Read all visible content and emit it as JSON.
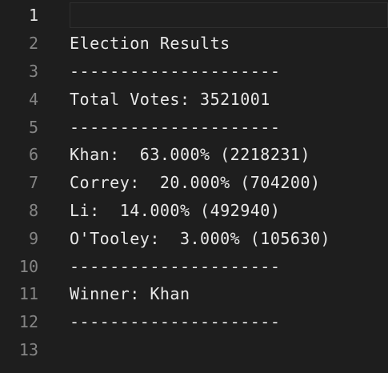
{
  "editor": {
    "lines": [
      {
        "number": "1",
        "text": ""
      },
      {
        "number": "2",
        "text": "Election Results"
      },
      {
        "number": "3",
        "text": "---------------------"
      },
      {
        "number": "4",
        "text": "Total Votes: 3521001"
      },
      {
        "number": "5",
        "text": "---------------------"
      },
      {
        "number": "6",
        "text": "Khan:  63.000% (2218231)"
      },
      {
        "number": "7",
        "text": "Correy:  20.000% (704200)"
      },
      {
        "number": "8",
        "text": "Li:  14.000% (492940)"
      },
      {
        "number": "9",
        "text": "O'Tooley:  3.000% (105630)"
      },
      {
        "number": "10",
        "text": "---------------------"
      },
      {
        "number": "11",
        "text": "Winner: Khan"
      },
      {
        "number": "12",
        "text": "---------------------"
      },
      {
        "number": "13",
        "text": ""
      }
    ]
  }
}
